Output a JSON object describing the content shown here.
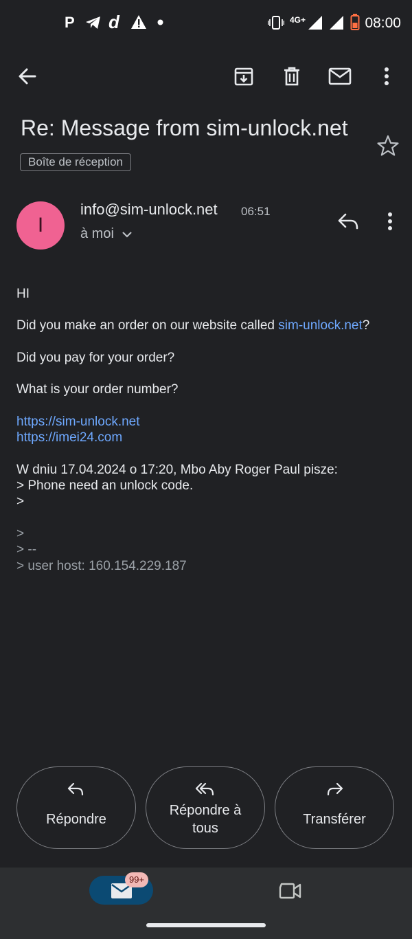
{
  "status_bar": {
    "left_glyphs": [
      "P",
      "d"
    ],
    "network": "4G+",
    "time": "08:00"
  },
  "app_bar": {
    "back_icon": "arrow-left",
    "actions": [
      "archive-icon",
      "delete-icon",
      "mark-unread-icon",
      "more-vert-icon"
    ]
  },
  "email": {
    "subject": "Re: Message from sim-unlock.net",
    "label": "Boîte de réception",
    "sender": {
      "initial": "I",
      "address": "info@sim-unlock.net",
      "time": "06:51",
      "to": "à moi"
    },
    "body": {
      "greeting": "HI",
      "q1_prefix": "Did you make an order on our website called ",
      "q1_link": "sim-unlock.net",
      "q1_suffix": "?",
      "q2": "Did you pay for your order?",
      "q3": "What is your order number?",
      "link1": "https://sim-unlock.net",
      "link2": "https://imei24.com",
      "quote_header": "W dniu 17.04.2024 o 17:20, Mbo Aby Roger Paul pisze:",
      "quote_line1": "> Phone need an unlock code.",
      "quote_line2": ">",
      "quote_line3": ">",
      "quote_line4": "> --",
      "quote_line5": "> user host: 160.154.229.187"
    }
  },
  "actions": {
    "reply": "Répondre",
    "reply_all_line1": "Répondre à",
    "reply_all_line2": "tous",
    "forward": "Transférer"
  },
  "bottom_nav": {
    "mail_badge": "99+"
  },
  "colors": {
    "background": "#202124",
    "avatar": "#f06292",
    "link": "#6ea8fe",
    "nav_selected": "#0b4a73",
    "badge": "#f2b8b5"
  }
}
